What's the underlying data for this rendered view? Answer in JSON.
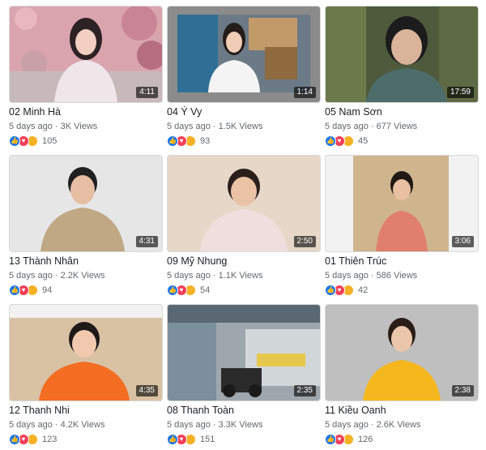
{
  "colors": {
    "like": "#1877f2",
    "love": "#f33e58",
    "wow": "#f7b125",
    "meta_text": "#65676b",
    "title_text": "#1c1e21"
  },
  "videos": [
    {
      "title": "02 Minh Hà",
      "ago": "5 days ago",
      "views": "3K Views",
      "duration": "4:11",
      "reactions": "105"
    },
    {
      "title": "04 Ý Vy",
      "ago": "5 days ago",
      "views": "1.5K Views",
      "duration": "1:14",
      "reactions": "93"
    },
    {
      "title": "05 Nam Sơn",
      "ago": "5 days ago",
      "views": "677 Views",
      "duration": "17:59",
      "reactions": "45"
    },
    {
      "title": "13 Thành Nhân",
      "ago": "5 days ago",
      "views": "2.2K Views",
      "duration": "4:31",
      "reactions": "94"
    },
    {
      "title": "09 Mỹ Nhung",
      "ago": "5 days ago",
      "views": "1.1K Views",
      "duration": "2:50",
      "reactions": "54"
    },
    {
      "title": "01 Thiên Trúc",
      "ago": "5 days ago",
      "views": "586 Views",
      "duration": "3:06",
      "reactions": "42"
    },
    {
      "title": "12 Thanh Nhi",
      "ago": "5 days ago",
      "views": "4.2K Views",
      "duration": "4:35",
      "reactions": "123"
    },
    {
      "title": "08 Thanh Toàn",
      "ago": "5 days ago",
      "views": "3.3K Views",
      "duration": "2:35",
      "reactions": "151"
    },
    {
      "title": "11 Kiều Oanh",
      "ago": "5 days ago",
      "views": "2.6K Views",
      "duration": "2:38",
      "reactions": "126"
    }
  ]
}
